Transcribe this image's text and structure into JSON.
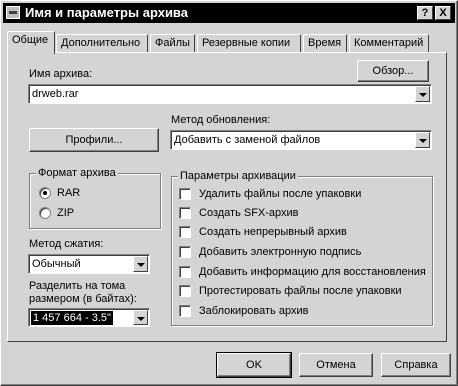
{
  "window": {
    "title": "Имя и параметры архива",
    "help_label": "?",
    "close_label": "X"
  },
  "tabs": [
    {
      "label": "Общие",
      "active": true
    },
    {
      "label": "Дополнительно",
      "active": false
    },
    {
      "label": "Файлы",
      "active": false
    },
    {
      "label": "Резервные копии",
      "active": false
    },
    {
      "label": "Время",
      "active": false
    },
    {
      "label": "Комментарий",
      "active": false
    }
  ],
  "archive_name": {
    "label": "Имя архива:",
    "value": "drweb.rar",
    "browse_label": "Обзор..."
  },
  "profiles_label": "Профили...",
  "update_method": {
    "label": "Метод обновления:",
    "value": "Добавить с заменой файлов"
  },
  "format": {
    "label": "Формат архива",
    "options": [
      {
        "label": "RAR",
        "checked": true
      },
      {
        "label": "ZIP",
        "checked": false
      }
    ]
  },
  "compression": {
    "label": "Метод сжатия:",
    "value": "Обычный"
  },
  "split": {
    "label_line1": "Разделить на тома",
    "label_line2": "размером (в байтах):",
    "value": "1 457 664 - 3.5\""
  },
  "options": {
    "label": "Параметры архивации",
    "items": [
      {
        "label": "Удалить файлы после упаковки",
        "checked": false
      },
      {
        "label": "Создать SFX-архив",
        "checked": false
      },
      {
        "label": "Создать непрерывный архив",
        "checked": false
      },
      {
        "label": "Добавить электронную подпись",
        "checked": false
      },
      {
        "label": "Добавить информацию для восстановления",
        "checked": false
      },
      {
        "label": "Протестировать файлы после упаковки",
        "checked": false
      },
      {
        "label": "Заблокировать архив",
        "checked": false
      }
    ]
  },
  "footer": {
    "ok_label": "OK",
    "cancel_label": "Отмена",
    "help_label": "Справка"
  }
}
